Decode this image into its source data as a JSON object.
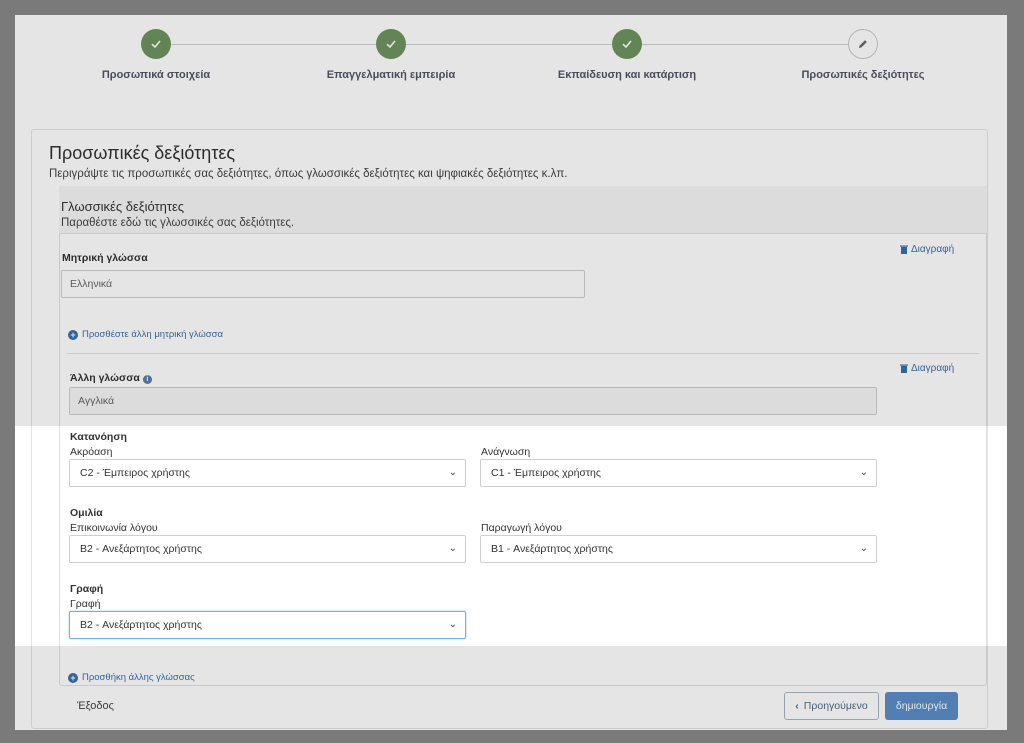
{
  "steps": [
    {
      "label": "Προσωπικά στοιχεία",
      "status": "done"
    },
    {
      "label": "Επαγγελματική εμπειρία",
      "status": "done"
    },
    {
      "label": "Εκπαίδευση και κατάρτιση",
      "status": "done"
    },
    {
      "label": "Προσωπικές δεξιότητες",
      "status": "current"
    }
  ],
  "page": {
    "title": "Προσωπικές δεξιότητες",
    "description": "Περιγράψτε τις προσωπικές σας δεξιότητες, όπως γλωσσικές δεξιότητες και ψηφιακές δεξιότητες κ.λπ."
  },
  "language_section": {
    "title": "Γλωσσικές δεξιότητες",
    "description": "Παραθέστε εδώ τις γλωσσικές σας δεξιότητες.",
    "delete_label": "Διαγραφή",
    "mother_tongue_label": "Μητρική γλώσσα",
    "mother_tongue_value": "Ελληνικά",
    "add_mother_tongue": "Προσθέστε άλλη μητρική γλώσσα",
    "other_language_label": "Άλλη γλώσσα",
    "other_language_value": "Αγγλικά",
    "understanding_heading": "Κατανόηση",
    "listening_label": "Ακρόαση",
    "listening_value": "C2 - Έμπειρος χρήστης",
    "reading_label": "Ανάγνωση",
    "reading_value": "C1 - Έμπειρος χρήστης",
    "speaking_heading": "Ομιλία",
    "interaction_label": "Επικοινωνία λόγου",
    "interaction_value": "B2 - Ανεξάρτητος χρήστης",
    "production_label": "Παραγωγή λόγου",
    "production_value": "B1 - Ανεξάρτητος χρήστης",
    "writing_heading": "Γραφή",
    "writing_label": "Γραφή",
    "writing_value": "B2 - Ανεξάρτητος χρήστης",
    "add_language": "Προσθήκη άλλης γλώσσας"
  },
  "footer": {
    "exit_label": "Έξοδος",
    "prev_label": "Προηγούμενο",
    "create_label": "δημιουργία"
  },
  "colors": {
    "step_done": "#6f9560",
    "link": "#3c6fa8",
    "primary_button": "#5b8ec9"
  }
}
